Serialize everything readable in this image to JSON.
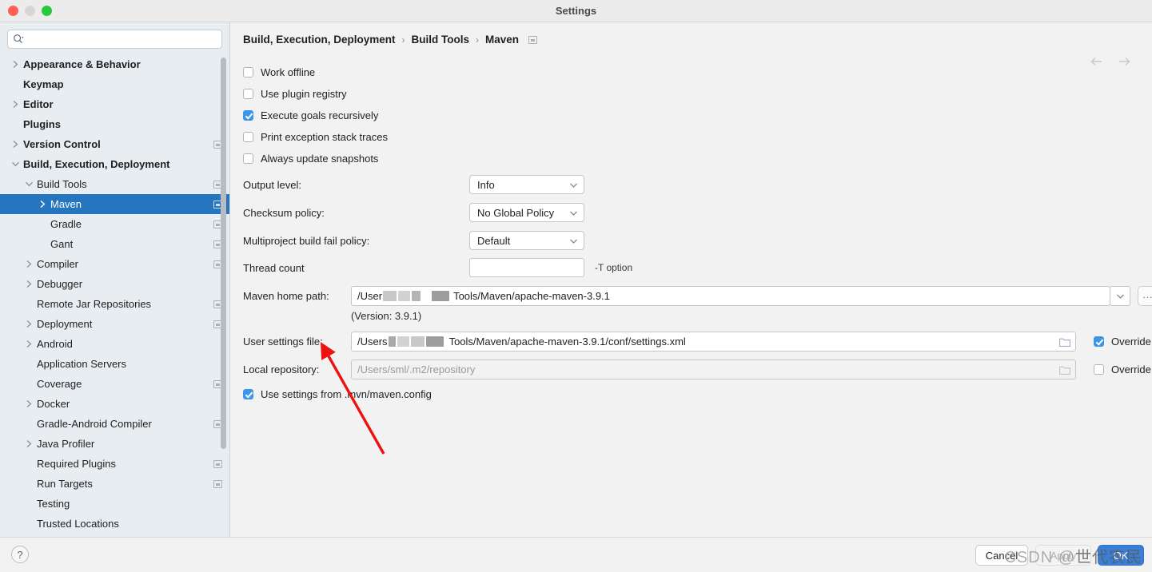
{
  "window": {
    "title": "Settings",
    "traffic_lights": [
      "close",
      "minimize",
      "zoom"
    ]
  },
  "sidebar": {
    "search": {
      "placeholder": "",
      "value": "",
      "icon": "search-icon"
    },
    "items": [
      {
        "label": "Appearance & Behavior",
        "indent": 0,
        "twisty": "right",
        "bold": true,
        "config": false,
        "selected": false
      },
      {
        "label": "Keymap",
        "indent": 0,
        "twisty": "none",
        "bold": true,
        "config": false,
        "selected": false
      },
      {
        "label": "Editor",
        "indent": 0,
        "twisty": "right",
        "bold": true,
        "config": false,
        "selected": false
      },
      {
        "label": "Plugins",
        "indent": 0,
        "twisty": "none",
        "bold": true,
        "config": false,
        "selected": false
      },
      {
        "label": "Version Control",
        "indent": 0,
        "twisty": "right",
        "bold": true,
        "config": true,
        "selected": false
      },
      {
        "label": "Build, Execution, Deployment",
        "indent": 0,
        "twisty": "down",
        "bold": true,
        "config": false,
        "selected": false
      },
      {
        "label": "Build Tools",
        "indent": 1,
        "twisty": "down",
        "bold": false,
        "config": true,
        "selected": false
      },
      {
        "label": "Maven",
        "indent": 2,
        "twisty": "right",
        "bold": false,
        "config": true,
        "selected": true
      },
      {
        "label": "Gradle",
        "indent": 2,
        "twisty": "none",
        "bold": false,
        "config": true,
        "selected": false
      },
      {
        "label": "Gant",
        "indent": 2,
        "twisty": "none",
        "bold": false,
        "config": true,
        "selected": false
      },
      {
        "label": "Compiler",
        "indent": 1,
        "twisty": "right",
        "bold": false,
        "config": true,
        "selected": false
      },
      {
        "label": "Debugger",
        "indent": 1,
        "twisty": "right",
        "bold": false,
        "config": false,
        "selected": false
      },
      {
        "label": "Remote Jar Repositories",
        "indent": 1,
        "twisty": "none",
        "bold": false,
        "config": true,
        "selected": false
      },
      {
        "label": "Deployment",
        "indent": 1,
        "twisty": "right",
        "bold": false,
        "config": true,
        "selected": false
      },
      {
        "label": "Android",
        "indent": 1,
        "twisty": "right",
        "bold": false,
        "config": false,
        "selected": false
      },
      {
        "label": "Application Servers",
        "indent": 1,
        "twisty": "none",
        "bold": false,
        "config": false,
        "selected": false
      },
      {
        "label": "Coverage",
        "indent": 1,
        "twisty": "none",
        "bold": false,
        "config": true,
        "selected": false
      },
      {
        "label": "Docker",
        "indent": 1,
        "twisty": "right",
        "bold": false,
        "config": false,
        "selected": false
      },
      {
        "label": "Gradle-Android Compiler",
        "indent": 1,
        "twisty": "none",
        "bold": false,
        "config": true,
        "selected": false
      },
      {
        "label": "Java Profiler",
        "indent": 1,
        "twisty": "right",
        "bold": false,
        "config": false,
        "selected": false
      },
      {
        "label": "Required Plugins",
        "indent": 1,
        "twisty": "none",
        "bold": false,
        "config": true,
        "selected": false
      },
      {
        "label": "Run Targets",
        "indent": 1,
        "twisty": "none",
        "bold": false,
        "config": true,
        "selected": false
      },
      {
        "label": "Testing",
        "indent": 1,
        "twisty": "none",
        "bold": false,
        "config": false,
        "selected": false
      },
      {
        "label": "Trusted Locations",
        "indent": 1,
        "twisty": "none",
        "bold": false,
        "config": false,
        "selected": false
      }
    ]
  },
  "main": {
    "breadcrumb": [
      "Build, Execution, Deployment",
      "Build Tools",
      "Maven"
    ],
    "breadcrumb_separator": "›",
    "nav": {
      "back_icon": "arrow-left-icon",
      "forward_icon": "arrow-right-icon",
      "enabled": false
    },
    "checkboxes": [
      {
        "label": "Work offline",
        "checked": false
      },
      {
        "label": "Use plugin registry",
        "checked": false
      },
      {
        "label": "Execute goals recursively",
        "checked": true
      },
      {
        "label": "Print exception stack traces",
        "checked": false
      },
      {
        "label": "Always update snapshots",
        "checked": false
      }
    ],
    "selects": [
      {
        "label": "Output level:",
        "value": "Info"
      },
      {
        "label": "Checksum policy:",
        "value": "No Global Policy"
      },
      {
        "label": "Multiproject build fail policy:",
        "value": "Default"
      }
    ],
    "thread_count": {
      "label": "Thread count",
      "value": "",
      "hint": "-T option"
    },
    "maven_home": {
      "label": "Maven home path:",
      "value_prefix": "/User",
      "value_suffix": "Tools/Maven/apache-maven-3.9.1",
      "redacted": true,
      "version_note": "(Version: 3.9.1)",
      "dropdown_icon": "chevron-down-icon",
      "browse_label": "..."
    },
    "user_settings": {
      "label": "User settings file:",
      "value_prefix": "/Users",
      "value_suffix": "Tools/Maven/apache-maven-3.9.1/conf/settings.xml",
      "redacted": true,
      "folder_icon": "folder-icon",
      "override_label": "Override",
      "override_checked": true
    },
    "local_repository": {
      "label": "Local repository:",
      "value": "/Users/sml/.m2/repository",
      "disabled": true,
      "folder_icon": "folder-icon",
      "override_label": "Override",
      "override_checked": false
    },
    "mvn_config": {
      "label": "Use settings from .mvn/maven.config",
      "checked": true
    }
  },
  "footer": {
    "help_label": "?",
    "cancel_label": "Cancel",
    "apply_label": "Apply",
    "ok_label": "OK"
  },
  "annotations": {
    "arrow_color": "#ee1111",
    "watermark_prefix": "CSDN @",
    "watermark_text": "世代农民"
  },
  "colors": {
    "selection": "#2675bf",
    "checkbox_accent": "#3b95e8",
    "primary_button": "#3a7fd5",
    "sidebar_bg": "#e8edf1",
    "panel_bg": "#f2f2f2"
  }
}
